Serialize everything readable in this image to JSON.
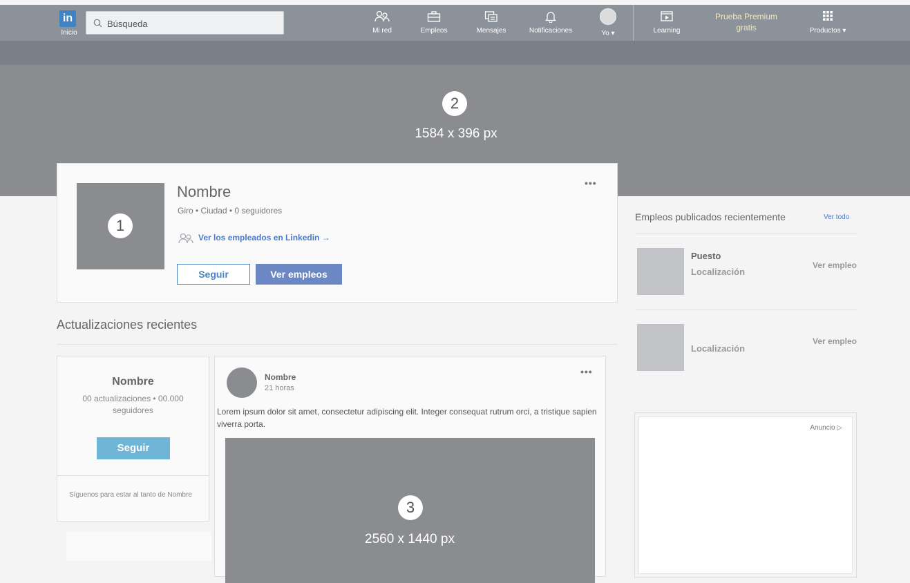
{
  "nav": {
    "logo_text": "in",
    "home_label": "Inicio",
    "search_placeholder": "Búsqueda",
    "items": [
      {
        "label": "Mi red",
        "icon": "network-icon"
      },
      {
        "label": "Empleos",
        "icon": "briefcase-icon"
      },
      {
        "label": "Mensajes",
        "icon": "messages-icon"
      },
      {
        "label": "Notificaciones",
        "icon": "bell-icon"
      },
      {
        "label": "Yo ▾",
        "icon": "avatar"
      }
    ],
    "learning_label": "Learning",
    "premium_line1": "Prueba Premium",
    "premium_line2": "gratis",
    "products_label": "Productos ▾"
  },
  "cover": {
    "badge": "2",
    "dimensions": "1584 x 396 px"
  },
  "profile": {
    "logo_badge": "1",
    "name": "Nombre",
    "meta": "Giro • Ciudad • 0 seguidores",
    "employees_link": "Ver los empleados en Linkedin →",
    "follow_button": "Seguir",
    "jobs_button": "Ver empleos",
    "more": "•••"
  },
  "updates": {
    "title": "Actualizaciones recientes"
  },
  "follow_card": {
    "name": "Nombre",
    "stats": "00 actualizaciones • 00.000 seguidores",
    "button": "Seguir",
    "note": "Síguenos para estar al tanto de Nombre"
  },
  "post": {
    "author": "Nombre",
    "time": "21 horas",
    "text": "Lorem ipsum dolor sit amet, consectetur adipiscing elit. Integer consequat rutrum orci, a tristique sapien viverra porta.",
    "more": "•••",
    "image_badge": "3",
    "image_dimensions": "2560 x 1440 px"
  },
  "sidebar": {
    "jobs_title": "Empleos publicados recientemente",
    "see_all": "Ver todo",
    "jobs": [
      {
        "title": "Puesto",
        "location": "Localización",
        "link": "Ver empleo"
      },
      {
        "title": "",
        "location": "Localización",
        "link": "Ver empleo"
      }
    ],
    "ad_label": "Anuncio ▷"
  }
}
